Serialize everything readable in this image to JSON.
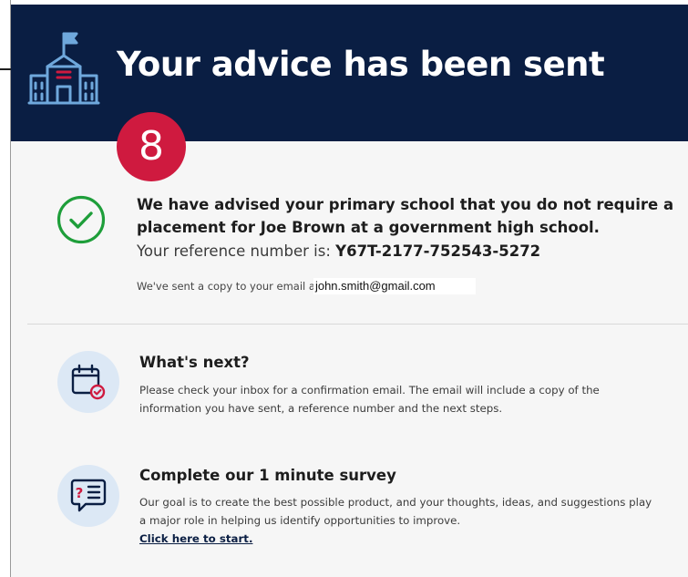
{
  "header": {
    "title": "Your advice has been sent",
    "icon": "school-building-icon"
  },
  "step_badge": "8",
  "confirmation": {
    "message": "We have advised your primary school that you do not require a placement for Joe Brown at a government high school.",
    "reference_label": "Your reference number is: ",
    "reference_number": "Y67T-2177-752543-5272",
    "email_label": "We've sent a copy to your email a",
    "email": "john.smith@gmail.com"
  },
  "whats_next": {
    "title": "What's next?",
    "text": "Please check your inbox for a confirmation email. The email will include a copy of the information you have sent, a reference number and the next steps."
  },
  "survey": {
    "title": "Complete our 1 minute survey",
    "text": "Our goal is to create the best possible product, and your thoughts, ideas, and suggestions play a major role in helping us identify opportunities to improve.",
    "link_label": "Click here to start."
  },
  "colors": {
    "header_bg": "#0a1e43",
    "badge": "#cf1a3f",
    "success": "#1e9e3a",
    "icon_bg": "#dce8f5",
    "icon_stroke": "#0a1e43"
  }
}
